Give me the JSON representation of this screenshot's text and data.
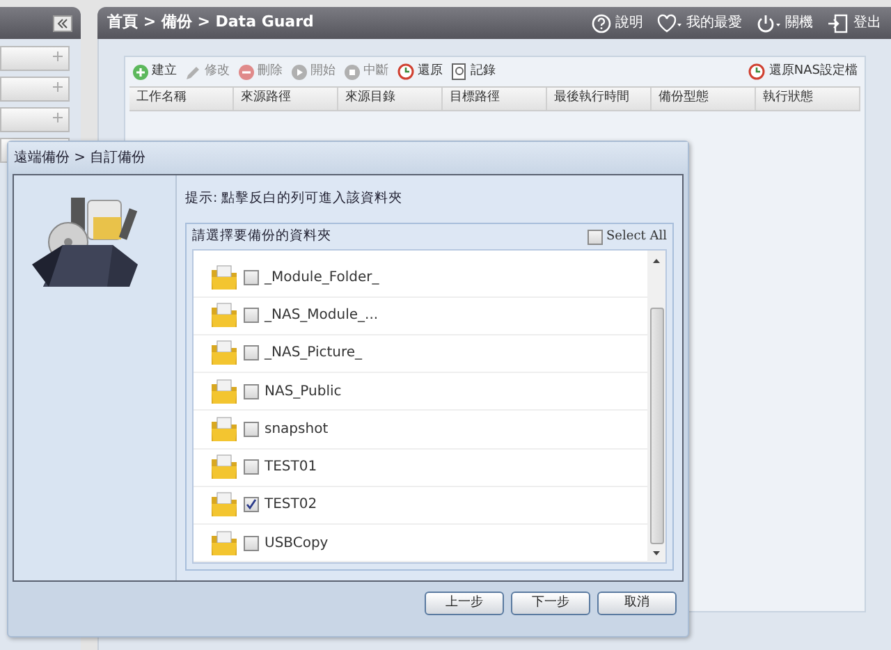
{
  "header": {
    "breadcrumb": "首頁 > 備份 > Data Guard",
    "links": [
      {
        "kind": "help",
        "label": "說明"
      },
      {
        "kind": "favorite",
        "label": "我的最愛"
      },
      {
        "kind": "power",
        "label": "關機"
      },
      {
        "kind": "logout",
        "label": "登出"
      }
    ]
  },
  "toolbar": {
    "items": [
      {
        "kind": "add",
        "label": "建立",
        "disabled": false
      },
      {
        "kind": "edit",
        "label": "修改",
        "disabled": true
      },
      {
        "kind": "delete",
        "label": "刪除",
        "disabled": true
      },
      {
        "kind": "start",
        "label": "開始",
        "disabled": true
      },
      {
        "kind": "stop",
        "label": "中斷",
        "disabled": true
      },
      {
        "kind": "restore",
        "label": "還原",
        "disabled": false
      },
      {
        "kind": "log",
        "label": "記錄",
        "disabled": false
      }
    ],
    "right": {
      "kind": "restore",
      "label": "還原NAS設定檔"
    }
  },
  "table": {
    "columns": [
      "工作名稱",
      "來源路徑",
      "來源目錄",
      "目標路徑",
      "最後執行時間",
      "備份型態",
      "執行狀態"
    ]
  },
  "dialog": {
    "title": "遠端備份 > 自訂備份",
    "hint": "提示: 點擊反白的列可進入該資料夾",
    "list_title": "請選擇要備份的資料夾",
    "select_all": {
      "label": "Select All",
      "checked": false
    },
    "folders": [
      {
        "name": "_Module_Folder_",
        "checked": false
      },
      {
        "name": "_NAS_Module_...",
        "checked": false
      },
      {
        "name": "_NAS_Picture_",
        "checked": false
      },
      {
        "name": "NAS_Public",
        "checked": false
      },
      {
        "name": "snapshot",
        "checked": false
      },
      {
        "name": "TEST01",
        "checked": false
      },
      {
        "name": "TEST02",
        "checked": true
      },
      {
        "name": "USBCopy",
        "checked": false
      }
    ],
    "buttons": [
      "上一步",
      "下一步",
      "取消"
    ]
  }
}
